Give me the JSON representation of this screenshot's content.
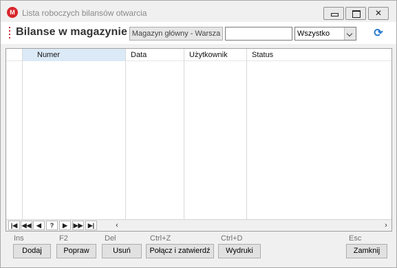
{
  "window": {
    "title": "Lista roboczych bilansów otwarcia",
    "app_icon_letter": "M"
  },
  "toolbar": {
    "page_title": "Bilanse w magazynie",
    "warehouse_label": "Magazyn główny - Warsza",
    "search_value": "",
    "filter_selected": "Wszystko",
    "refresh_icon": "refresh-icon"
  },
  "grid": {
    "columns": [
      "Numer",
      "Data",
      "Użytkownik",
      "Status"
    ],
    "rows": []
  },
  "navigation": {
    "buttons": [
      "|◀",
      "◀◀",
      "◀",
      "?",
      "▶",
      "▶▶",
      "▶|"
    ]
  },
  "actions": [
    {
      "shortcut": "Ins",
      "label": "Dodaj"
    },
    {
      "shortcut": "F2",
      "label": "Popraw"
    },
    {
      "shortcut": "Del",
      "label": "Usuń"
    },
    {
      "shortcut": "Ctrl+Z",
      "label": "Połącz i zatwierdź"
    },
    {
      "shortcut": "Ctrl+D",
      "label": "Wydruki"
    },
    {
      "shortcut": "Esc",
      "label": "Zamknij"
    }
  ],
  "colors": {
    "accent": "#d9262e",
    "refresh": "#2a7bd1",
    "selected_header": "#dceaf7"
  }
}
